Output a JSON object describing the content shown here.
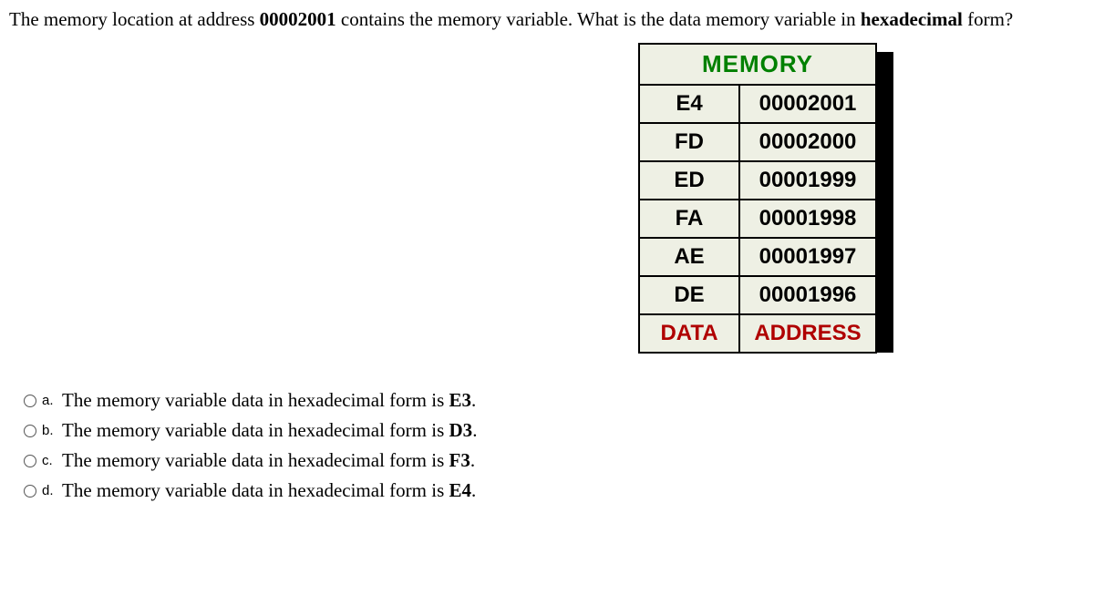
{
  "question": {
    "prefix": "The memory location at address ",
    "address": "00002001",
    "mid": " contains the memory variable. What is the  data memory variable  in ",
    "form": "hexadecimal",
    "suffix": " form?"
  },
  "memory": {
    "header": "MEMORY",
    "rows": [
      {
        "data": "E4",
        "addr": "00002001"
      },
      {
        "data": "FD",
        "addr": "00002000"
      },
      {
        "data": "ED",
        "addr": "00001999"
      },
      {
        "data": "FA",
        "addr": "00001998"
      },
      {
        "data": "AE",
        "addr": "00001997"
      },
      {
        "data": "DE",
        "addr": "00001996"
      }
    ],
    "footer_data": "DATA",
    "footer_addr": "ADDRESS"
  },
  "options": {
    "a": {
      "letter": "a.",
      "text": "The memory variable data in hexadecimal form is  ",
      "ans": "E3",
      "tail": "."
    },
    "b": {
      "letter": "b.",
      "text": "The memory variable data in hexadecimal form is  ",
      "ans": "D3",
      "tail": "."
    },
    "c": {
      "letter": "c.",
      "text": "The memory variable data in hexadecimal form is  ",
      "ans": "F3",
      "tail": "."
    },
    "d": {
      "letter": "d.",
      "text": "The memory variable data in hexadecimal form is  ",
      "ans": "E4",
      "tail": "."
    }
  }
}
